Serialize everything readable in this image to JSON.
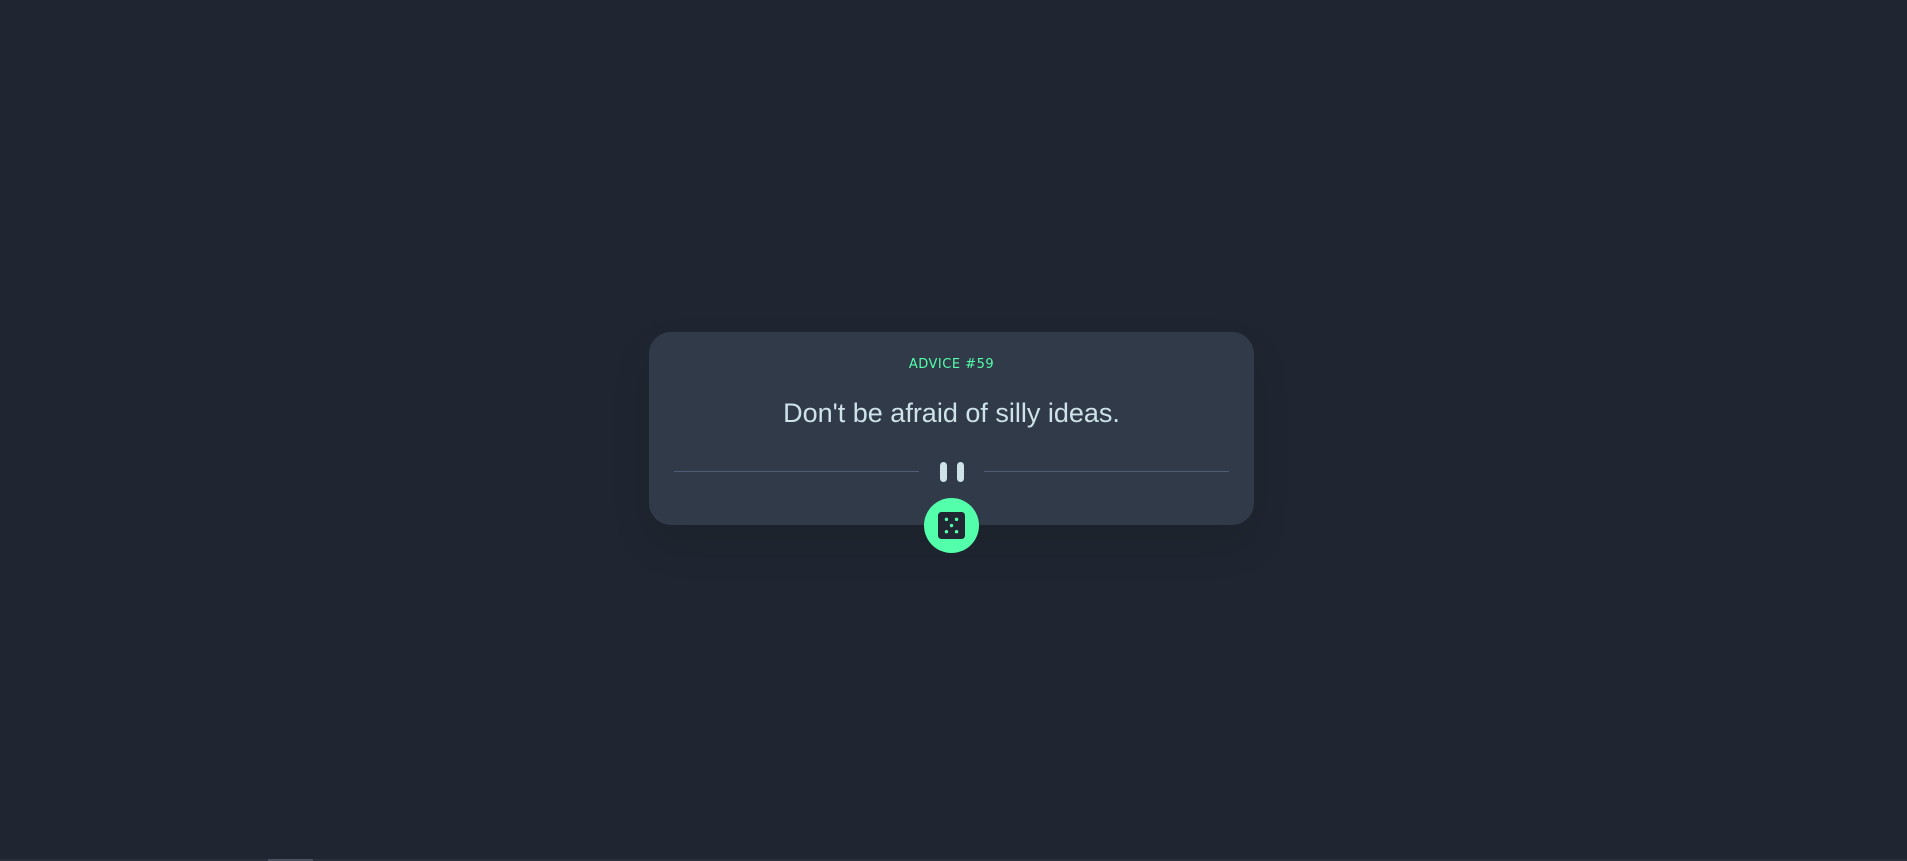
{
  "advice": {
    "label": "ADVICE #59",
    "text": "Don't be afraid of silly ideas."
  },
  "divider": {
    "icon": "pause-icon"
  },
  "button": {
    "icon": "dice-icon",
    "aria_label": "Get new advice"
  },
  "colors": {
    "background": "#1f2631",
    "card": "#313a49",
    "accent": "#53ffaa",
    "text": "#cee3e9",
    "divider": "#4f5d74"
  }
}
